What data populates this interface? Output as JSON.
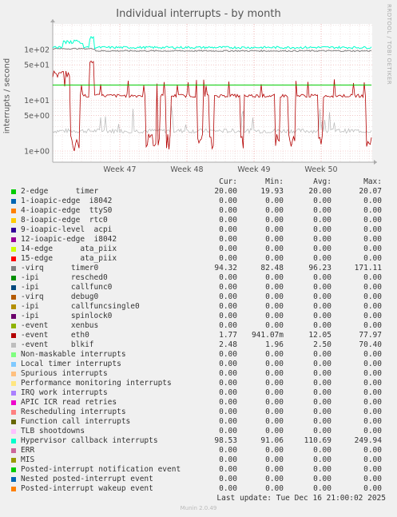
{
  "chart_data": {
    "type": "line",
    "title": "Individual interrupts - by month",
    "ylabel": "interrupts / second",
    "yscale": "log",
    "ylim": [
      0.5,
      250
    ],
    "y_ticks": [
      "1e+00",
      "5e+00",
      "1e+01",
      "5e+01",
      "1e+02"
    ],
    "x_ticks": [
      "Week 47",
      "Week 48",
      "Week 49",
      "Week 50"
    ],
    "side_note": "RRDTOOL / TOBI OETIKER",
    "columns": [
      "Cur:",
      "Min:",
      "Avg:",
      "Max:"
    ],
    "series": [
      {
        "name": "2-edge      timer",
        "color": "#00cc00",
        "cur": "20.00",
        "min": "19.93",
        "avg": "20.00",
        "max": "20.07",
        "level": 20
      },
      {
        "name": "1-ioapic-edge  i8042",
        "color": "#0066b3",
        "cur": "0.00",
        "min": "0.00",
        "avg": "0.00",
        "max": "0.00"
      },
      {
        "name": "4-ioapic-edge  ttyS0",
        "color": "#ff8000",
        "cur": "0.00",
        "min": "0.00",
        "avg": "0.00",
        "max": "0.00"
      },
      {
        "name": "8-ioapic-edge  rtc0",
        "color": "#ffcc00",
        "cur": "0.00",
        "min": "0.00",
        "avg": "0.00",
        "max": "0.00"
      },
      {
        "name": "9-ioapic-level  acpi",
        "color": "#330099",
        "cur": "0.00",
        "min": "0.00",
        "avg": "0.00",
        "max": "0.00"
      },
      {
        "name": "12-ioapic-edge  i8042",
        "color": "#990099",
        "cur": "0.00",
        "min": "0.00",
        "avg": "0.00",
        "max": "0.00"
      },
      {
        "name": "14-edge      ata_piix",
        "color": "#ccff00",
        "cur": "0.00",
        "min": "0.00",
        "avg": "0.00",
        "max": "0.00"
      },
      {
        "name": "15-edge      ata_piix",
        "color": "#ff0000",
        "cur": "0.00",
        "min": "0.00",
        "avg": "0.00",
        "max": "0.00"
      },
      {
        "name": "-virq      timer0",
        "color": "#808080",
        "cur": "94.32",
        "min": "82.48",
        "avg": "96.23",
        "max": "171.11",
        "level": 95
      },
      {
        "name": "-ipi       resched0",
        "color": "#008f00",
        "cur": "0.00",
        "min": "0.00",
        "avg": "0.00",
        "max": "0.00"
      },
      {
        "name": "-ipi       callfunc0",
        "color": "#00487d",
        "cur": "0.00",
        "min": "0.00",
        "avg": "0.00",
        "max": "0.00"
      },
      {
        "name": "-virq      debug0",
        "color": "#b35a00",
        "cur": "0.00",
        "min": "0.00",
        "avg": "0.00",
        "max": "0.00"
      },
      {
        "name": "-ipi       callfuncsingle0",
        "color": "#b38f00",
        "cur": "0.00",
        "min": "0.00",
        "avg": "0.00",
        "max": "0.00"
      },
      {
        "name": "-ipi       spinlock0",
        "color": "#6b006b",
        "cur": "0.00",
        "min": "0.00",
        "avg": "0.00",
        "max": "0.00"
      },
      {
        "name": "-event     xenbus",
        "color": "#8fb300",
        "cur": "0.00",
        "min": "0.00",
        "avg": "0.00",
        "max": "0.00"
      },
      {
        "name": "-event     eth0",
        "color": "#b30000",
        "cur": "1.77",
        "min": "941.07m",
        "avg": "12.05",
        "max": "77.97",
        "level": 12
      },
      {
        "name": "-event     blkif",
        "color": "#bebebe",
        "cur": "2.48",
        "min": "1.96",
        "avg": "2.50",
        "max": "70.40",
        "level": 2.5
      },
      {
        "name": "Non-maskable interrupts",
        "color": "#80ff80",
        "cur": "0.00",
        "min": "0.00",
        "avg": "0.00",
        "max": "0.00"
      },
      {
        "name": "Local timer interrupts",
        "color": "#80c9ff",
        "cur": "0.00",
        "min": "0.00",
        "avg": "0.00",
        "max": "0.00"
      },
      {
        "name": "Spurious interrupts",
        "color": "#ffc080",
        "cur": "0.00",
        "min": "0.00",
        "avg": "0.00",
        "max": "0.00"
      },
      {
        "name": "Performance monitoring interrupts",
        "color": "#ffe680",
        "cur": "0.00",
        "min": "0.00",
        "avg": "0.00",
        "max": "0.00"
      },
      {
        "name": "IRQ work interrupts",
        "color": "#aa80ff",
        "cur": "0.00",
        "min": "0.00",
        "avg": "0.00",
        "max": "0.00"
      },
      {
        "name": "APIC ICR read retries",
        "color": "#ee00cc",
        "cur": "0.00",
        "min": "0.00",
        "avg": "0.00",
        "max": "0.00"
      },
      {
        "name": "Rescheduling interrupts",
        "color": "#ff8080",
        "cur": "0.00",
        "min": "0.00",
        "avg": "0.00",
        "max": "0.00"
      },
      {
        "name": "Function call interrupts",
        "color": "#666600",
        "cur": "0.00",
        "min": "0.00",
        "avg": "0.00",
        "max": "0.00"
      },
      {
        "name": "TLB shootdowns",
        "color": "#ffbfff",
        "cur": "0.00",
        "min": "0.00",
        "avg": "0.00",
        "max": "0.00"
      },
      {
        "name": "Hypervisor callback interrupts",
        "color": "#00ffcc",
        "cur": "98.53",
        "min": "91.06",
        "avg": "110.69",
        "max": "249.94",
        "level": 110
      },
      {
        "name": "ERR",
        "color": "#cc6699",
        "cur": "0.00",
        "min": "0.00",
        "avg": "0.00",
        "max": "0.00"
      },
      {
        "name": "MIS",
        "color": "#999900",
        "cur": "0.00",
        "min": "0.00",
        "avg": "0.00",
        "max": "0.00"
      },
      {
        "name": "Posted-interrupt notification event",
        "color": "#00cc00",
        "cur": "0.00",
        "min": "0.00",
        "avg": "0.00",
        "max": "0.00"
      },
      {
        "name": "Nested posted-interrupt event",
        "color": "#0066b3",
        "cur": "0.00",
        "min": "0.00",
        "avg": "0.00",
        "max": "0.00"
      },
      {
        "name": "Posted-interrupt wakeup event",
        "color": "#ff8000",
        "cur": "0.00",
        "min": "0.00",
        "avg": "0.00",
        "max": "0.00"
      }
    ],
    "last_update": "Last update: Tue Dec 16 21:00:02 2025",
    "generator": "Munin 2.0.49"
  }
}
